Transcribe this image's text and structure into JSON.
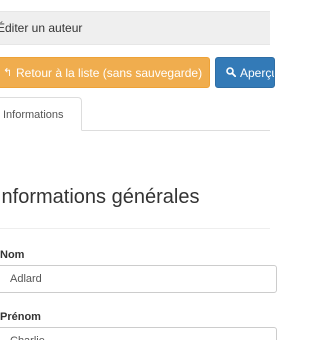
{
  "header": {
    "title": "Éditer un auteur"
  },
  "toolbar": {
    "back_label": "Retour à la liste (sans sauvegarde)",
    "preview_label": "Aperçu"
  },
  "tabs": [
    {
      "label": "Informations"
    }
  ],
  "section": {
    "title": "Informations générales"
  },
  "form": {
    "nom": {
      "label": "Nom",
      "value": "Adlard"
    },
    "prenom": {
      "label": "Prénom",
      "value": "Charlie"
    }
  },
  "colors": {
    "back_button": "#f0ad4e",
    "preview_button": "#337ab7",
    "header_bg": "#efefef"
  },
  "icons": {
    "back": "reply-arrow-icon",
    "preview": "search-icon"
  }
}
